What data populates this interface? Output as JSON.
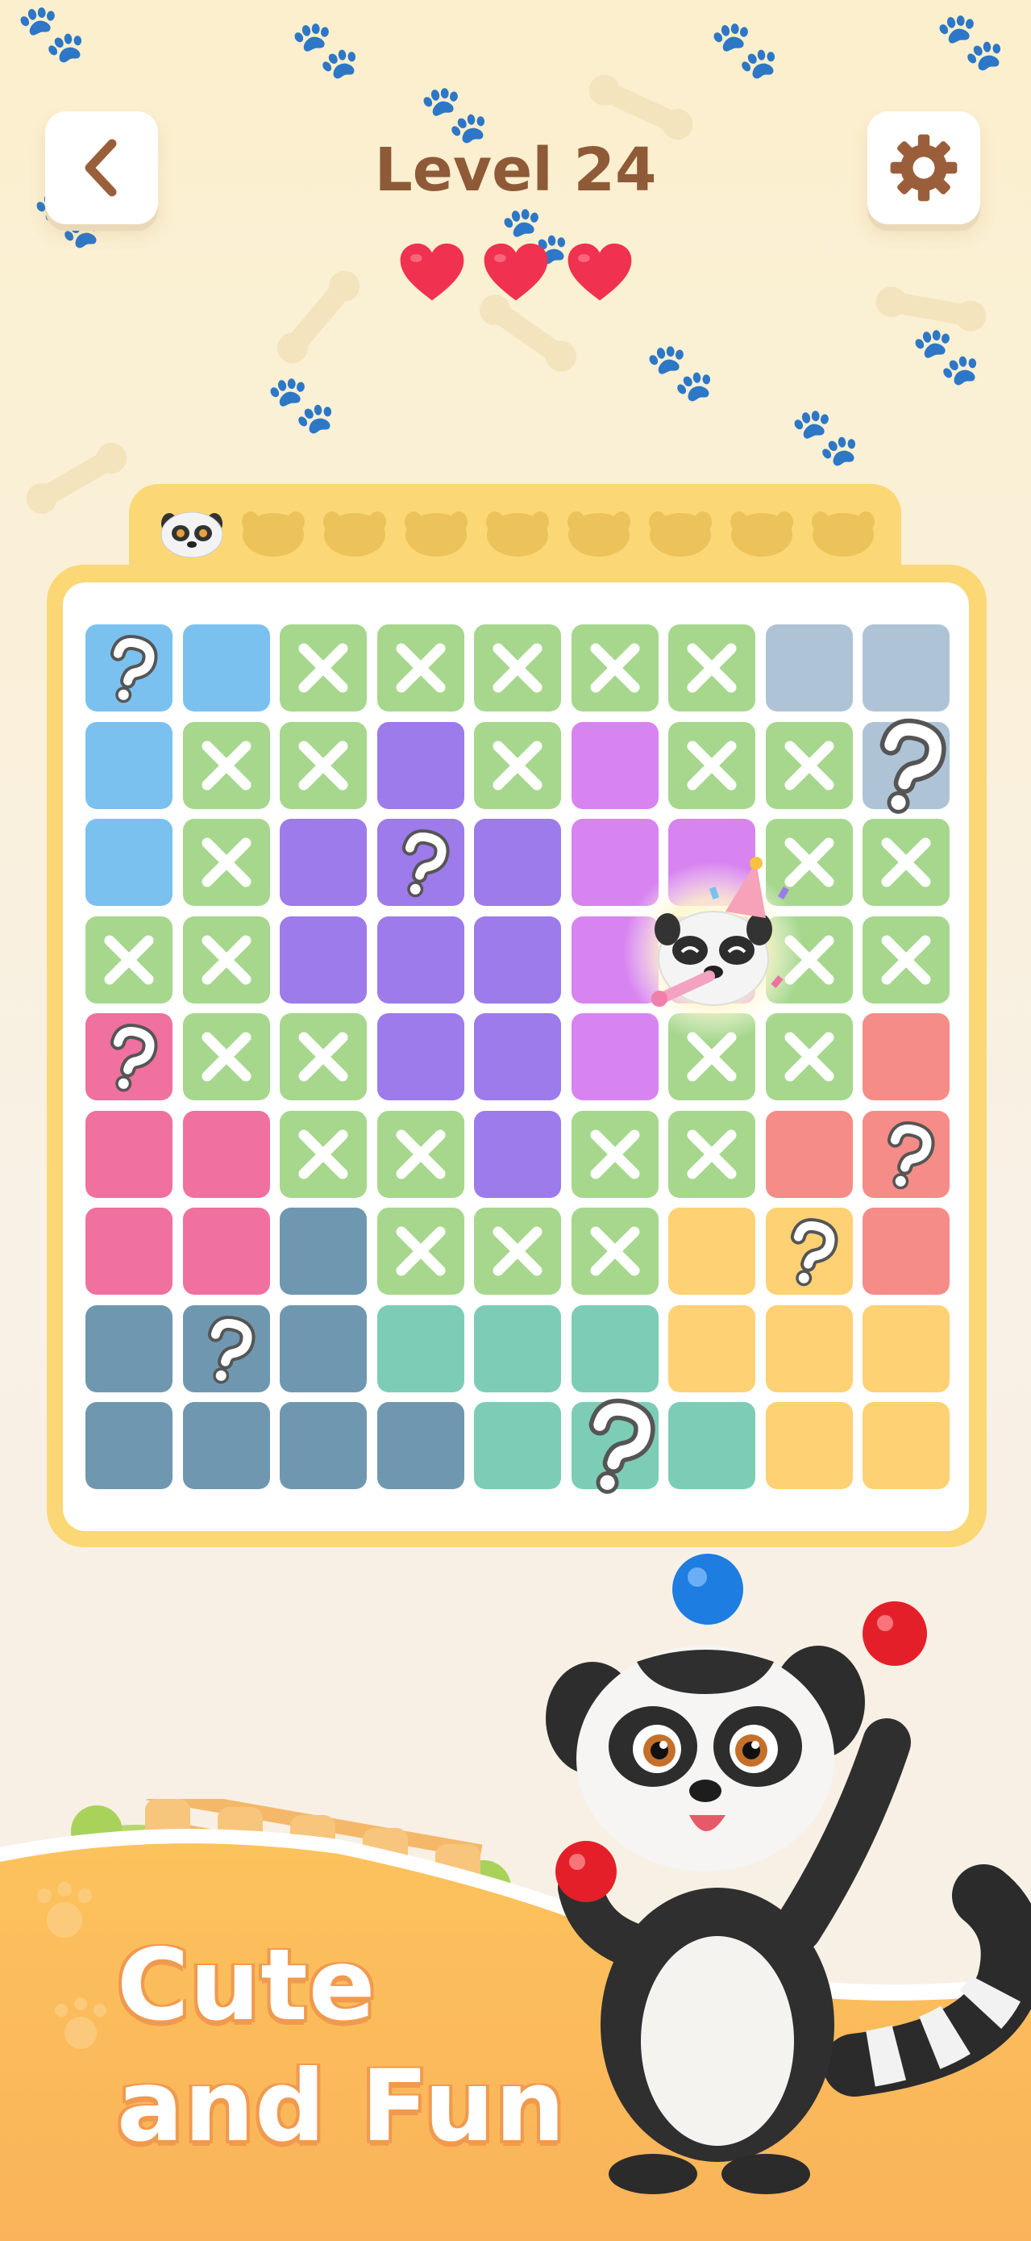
{
  "header": {
    "level_label": "Level 24",
    "back_icon": "chevron-left-icon",
    "settings_icon": "gear-icon",
    "lives": 3
  },
  "colors": {
    "blue": "#7bc1ef",
    "grey": "#aec4d6",
    "purple": "#9d7bea",
    "magenta": "#d784f0",
    "green_x": "#a6d78d",
    "pink": "#f0709f",
    "salmon": "#f68c87",
    "slate": "#6f98b0",
    "teal": "#7dcdb6",
    "yellow": "#fed174",
    "heart": "#f0314f",
    "title": "#8e5a37",
    "board_frame": "#fbd875"
  },
  "progress": {
    "found": 1,
    "total": 9
  },
  "grid": {
    "size": 9,
    "rows": [
      [
        "blue?",
        "blue",
        "x",
        "x",
        "x",
        "x",
        "x",
        "grey",
        "grey"
      ],
      [
        "blue",
        "x",
        "x",
        "purple",
        "x",
        "magenta",
        "x",
        "x",
        "grey?"
      ],
      [
        "blue",
        "x",
        "purple",
        "purple?",
        "purple",
        "magenta",
        "magenta",
        "x",
        "x"
      ],
      [
        "x",
        "x",
        "purple",
        "purple",
        "purple",
        "magenta",
        "magenta",
        "x",
        "x"
      ],
      [
        "pink?",
        "x",
        "x",
        "purple",
        "purple",
        "magenta",
        "x",
        "x",
        "salmon"
      ],
      [
        "pink",
        "pink",
        "x",
        "x",
        "purple",
        "x",
        "x",
        "salmon",
        "salmon?"
      ],
      [
        "pink",
        "pink",
        "slate",
        "x",
        "x",
        "x",
        "yellow",
        "yellow?",
        "salmon"
      ],
      [
        "slate",
        "slate?",
        "slate",
        "teal",
        "teal",
        "teal",
        "yellow",
        "yellow",
        "yellow"
      ],
      [
        "slate",
        "slate",
        "slate",
        "slate",
        "teal",
        "teal?",
        "teal",
        "yellow",
        "yellow"
      ]
    ]
  },
  "promo": {
    "line1": "Cute",
    "line2": "and Fun"
  }
}
